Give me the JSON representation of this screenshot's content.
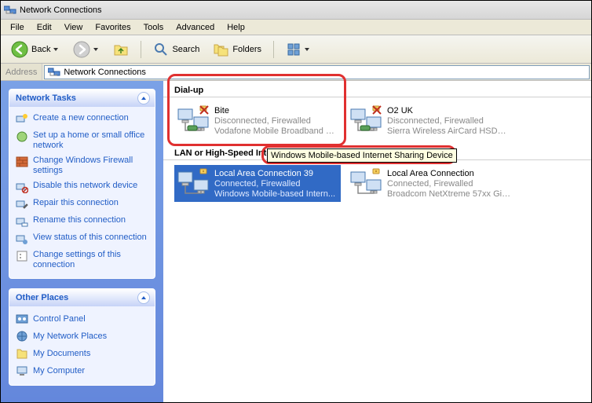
{
  "window": {
    "title": "Network Connections"
  },
  "menus": [
    "File",
    "Edit",
    "View",
    "Favorites",
    "Tools",
    "Advanced",
    "Help"
  ],
  "toolbar": {
    "back": "Back",
    "search": "Search",
    "folders": "Folders"
  },
  "address": {
    "label": "Address",
    "value": "Network Connections"
  },
  "sidebar": {
    "tasks_header": "Network Tasks",
    "tasks": [
      "Create a new connection",
      "Set up a home or small office network",
      "Change Windows Firewall settings",
      "Disable this network device",
      "Repair this connection",
      "Rename this connection",
      "View status of this connection",
      "Change settings of this connection"
    ],
    "places_header": "Other Places",
    "places": [
      "Control Panel",
      "My Network Places",
      "My Documents",
      "My Computer"
    ]
  },
  "content": {
    "groups": [
      {
        "header": "Dial-up",
        "items": [
          {
            "name": "Bite",
            "line2": "Disconnected, Firewalled",
            "line3": "Vodafone Mobile Broadband M...",
            "selected": false,
            "type": "dialup"
          },
          {
            "name": "O2 UK",
            "line2": "Disconnected, Firewalled",
            "line3": "Sierra Wireless AirCard HSDPA...",
            "selected": false,
            "type": "dialup"
          }
        ]
      },
      {
        "header": "LAN or High-Speed Internet",
        "items": [
          {
            "name": "Local Area Connection 39",
            "line2": "Connected, Firewalled",
            "line3": "Windows Mobile-based Intern...",
            "selected": true,
            "type": "lan"
          },
          {
            "name": "Local Area Connection",
            "line2": "Connected, Firewalled",
            "line3": "Broadcom NetXtreme 57xx Gig...",
            "selected": false,
            "type": "lan"
          }
        ]
      }
    ]
  },
  "tooltip": "Windows Mobile-based Internet Sharing Device"
}
